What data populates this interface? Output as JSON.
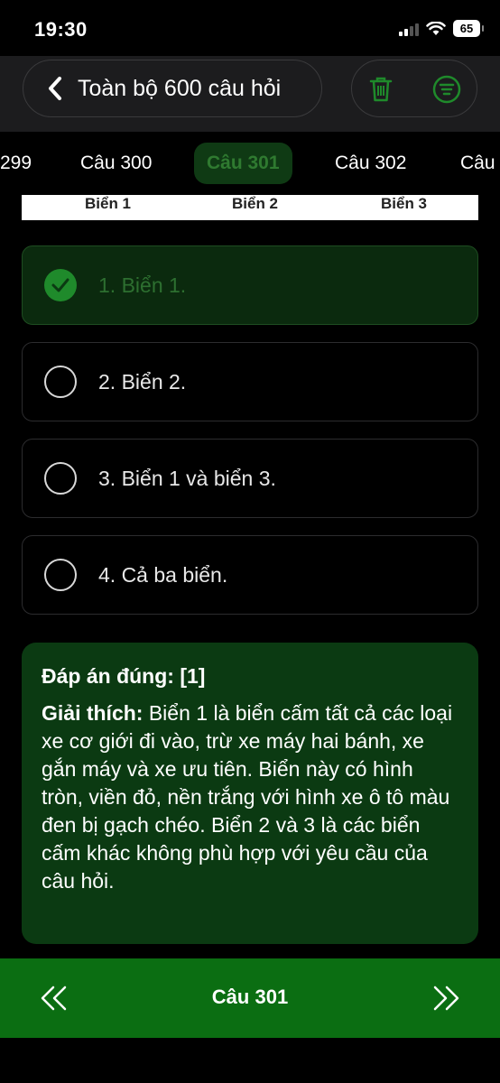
{
  "status": {
    "time": "19:30",
    "battery": "65"
  },
  "header": {
    "title": "Toàn bộ 600 câu hỏi"
  },
  "tabs": [
    {
      "label": "299"
    },
    {
      "label": "Câu 300"
    },
    {
      "label": "Câu 301",
      "active": true
    },
    {
      "label": "Câu 302"
    },
    {
      "label": "Câu"
    }
  ],
  "sign_labels": [
    "Biển 1",
    "Biển 2",
    "Biển 3"
  ],
  "answers": [
    {
      "label": "1. Biển 1.",
      "selected": true
    },
    {
      "label": "2. Biển 2.",
      "selected": false
    },
    {
      "label": "3. Biển 1 và biển 3.",
      "selected": false
    },
    {
      "label": "4. Cả ba biển.",
      "selected": false
    }
  ],
  "explanation": {
    "answer_line": "Đáp án đúng: [1]",
    "heading": "Giải thích:",
    "text": " Biển 1 là biển cấm tất cả các loại xe cơ giới đi vào, trừ xe máy hai bánh, xe gắn máy và xe ưu tiên. Biển này có hình tròn, viền đỏ, nền trắng với hình xe ô tô màu đen bị gạch chéo. Biển 2 và 3 là các biển cấm khác không phù hợp với yêu cầu của câu hỏi."
  },
  "bottom_nav": {
    "label": "Câu 301"
  },
  "colors": {
    "accent": "#1f8a2b",
    "bottom_bar": "#0b6e12",
    "explain_bg": "#0b3a12"
  }
}
